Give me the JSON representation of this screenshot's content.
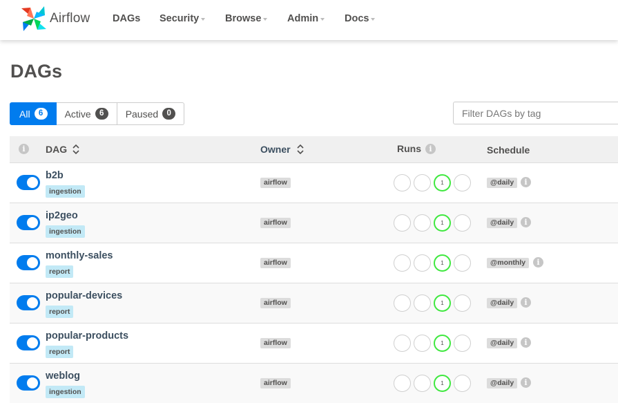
{
  "nav": {
    "brand": "Airflow",
    "items": [
      {
        "label": "DAGs",
        "has_caret": false
      },
      {
        "label": "Security",
        "has_caret": true
      },
      {
        "label": "Browse",
        "has_caret": true
      },
      {
        "label": "Admin",
        "has_caret": true
      },
      {
        "label": "Docs",
        "has_caret": true
      }
    ]
  },
  "page": {
    "title": "DAGs"
  },
  "filters": {
    "all": {
      "label": "All",
      "count": "6"
    },
    "active": {
      "label": "Active",
      "count": "6"
    },
    "paused": {
      "label": "Paused",
      "count": "0"
    }
  },
  "tag_filter": {
    "placeholder": "Filter DAGs by tag"
  },
  "table": {
    "headers": {
      "dag": "DAG",
      "owner": "Owner",
      "runs": "Runs",
      "schedule": "Schedule"
    },
    "rows": [
      {
        "dag": "b2b",
        "tag": "ingestion",
        "owner": "airflow",
        "run_count": "1",
        "schedule": "@daily"
      },
      {
        "dag": "ip2geo",
        "tag": "ingestion",
        "owner": "airflow",
        "run_count": "1",
        "schedule": "@daily"
      },
      {
        "dag": "monthly-sales",
        "tag": "report",
        "owner": "airflow",
        "run_count": "1",
        "schedule": "@monthly"
      },
      {
        "dag": "popular-devices",
        "tag": "report",
        "owner": "airflow",
        "run_count": "1",
        "schedule": "@daily"
      },
      {
        "dag": "popular-products",
        "tag": "report",
        "owner": "airflow",
        "run_count": "1",
        "schedule": "@daily"
      },
      {
        "dag": "weblog",
        "tag": "ingestion",
        "owner": "airflow",
        "run_count": "1",
        "schedule": "@daily"
      }
    ]
  },
  "colors": {
    "accent": "#017cee",
    "text": "#51504f",
    "dag_link": "#3c4f60",
    "tag_bg": "#c2e9f6",
    "success_ring": "#40e840"
  },
  "icons": [
    "airflow-logo-icon",
    "caret-down-icon",
    "info-icon",
    "sort-icon"
  ]
}
